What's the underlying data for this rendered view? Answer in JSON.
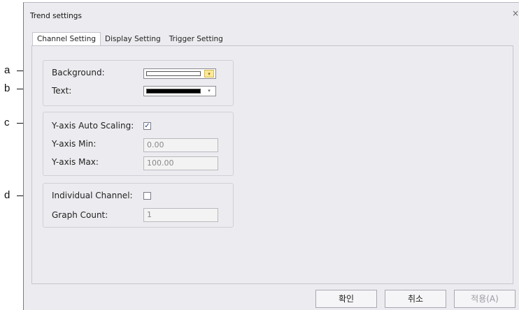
{
  "callouts": [
    "a",
    "b",
    "c",
    "d"
  ],
  "dialog": {
    "title": "Trend settings",
    "close_glyph": "×",
    "tabs": [
      {
        "label": "Channel Setting",
        "active": true
      },
      {
        "label": "Display Setting",
        "active": false
      },
      {
        "label": "Trigger Setting",
        "active": false
      }
    ]
  },
  "colors": {
    "group": {
      "background_label": "Background:",
      "background_color": "#ffffff",
      "text_label": "Text:",
      "text_color": "#000000",
      "dropdown_glyph": "▾"
    },
    "yaxis": {
      "auto_label": "Y-axis Auto Scaling:",
      "auto_checked": true,
      "check_glyph": "✓",
      "min_label": "Y-axis Min:",
      "min_value": "0.00",
      "max_label": "Y-axis Max:",
      "max_value": "100.00"
    },
    "channel": {
      "individual_label": "Individual Channel:",
      "individual_checked": false,
      "count_label": "Graph Count:",
      "count_value": "1"
    }
  },
  "buttons": {
    "ok": "확인",
    "cancel": "취소",
    "apply": "적용(A)"
  }
}
